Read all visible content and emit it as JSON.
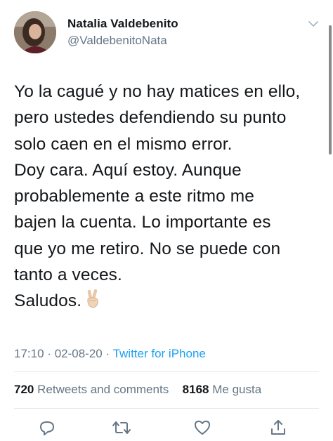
{
  "user": {
    "display_name": "Natalia Valdebenito",
    "handle": "@ValdebenitoNata"
  },
  "tweet": {
    "text": "Yo la cagué y no hay matices en ello,\npero ustedes defendiendo su punto\nsolo caen en el mismo error.\nDoy cara. Aquí estoy. Aunque\nprobablemente a este ritmo me\nbajen la cuenta. Lo importante es\nque yo me retiro. No se puede con\ntanto a veces.\nSaludos.",
    "emoji": "victory-hand"
  },
  "meta": {
    "time": "17:10",
    "separator1": "·",
    "date": "02-08-20",
    "separator2": "·",
    "source": "Twitter for iPhone"
  },
  "stats": {
    "retweets_count": "720",
    "retweets_label": "Retweets and comments",
    "likes_count": "8168",
    "likes_label": "Me gusta"
  },
  "actions": {
    "reply_icon": "reply-icon",
    "retweet_icon": "retweet-icon",
    "like_icon": "heart-icon",
    "share_icon": "share-icon"
  },
  "colors": {
    "text": "#14171a",
    "secondary": "#657786",
    "link": "#1da1f2",
    "divider": "#e1e8ed"
  }
}
